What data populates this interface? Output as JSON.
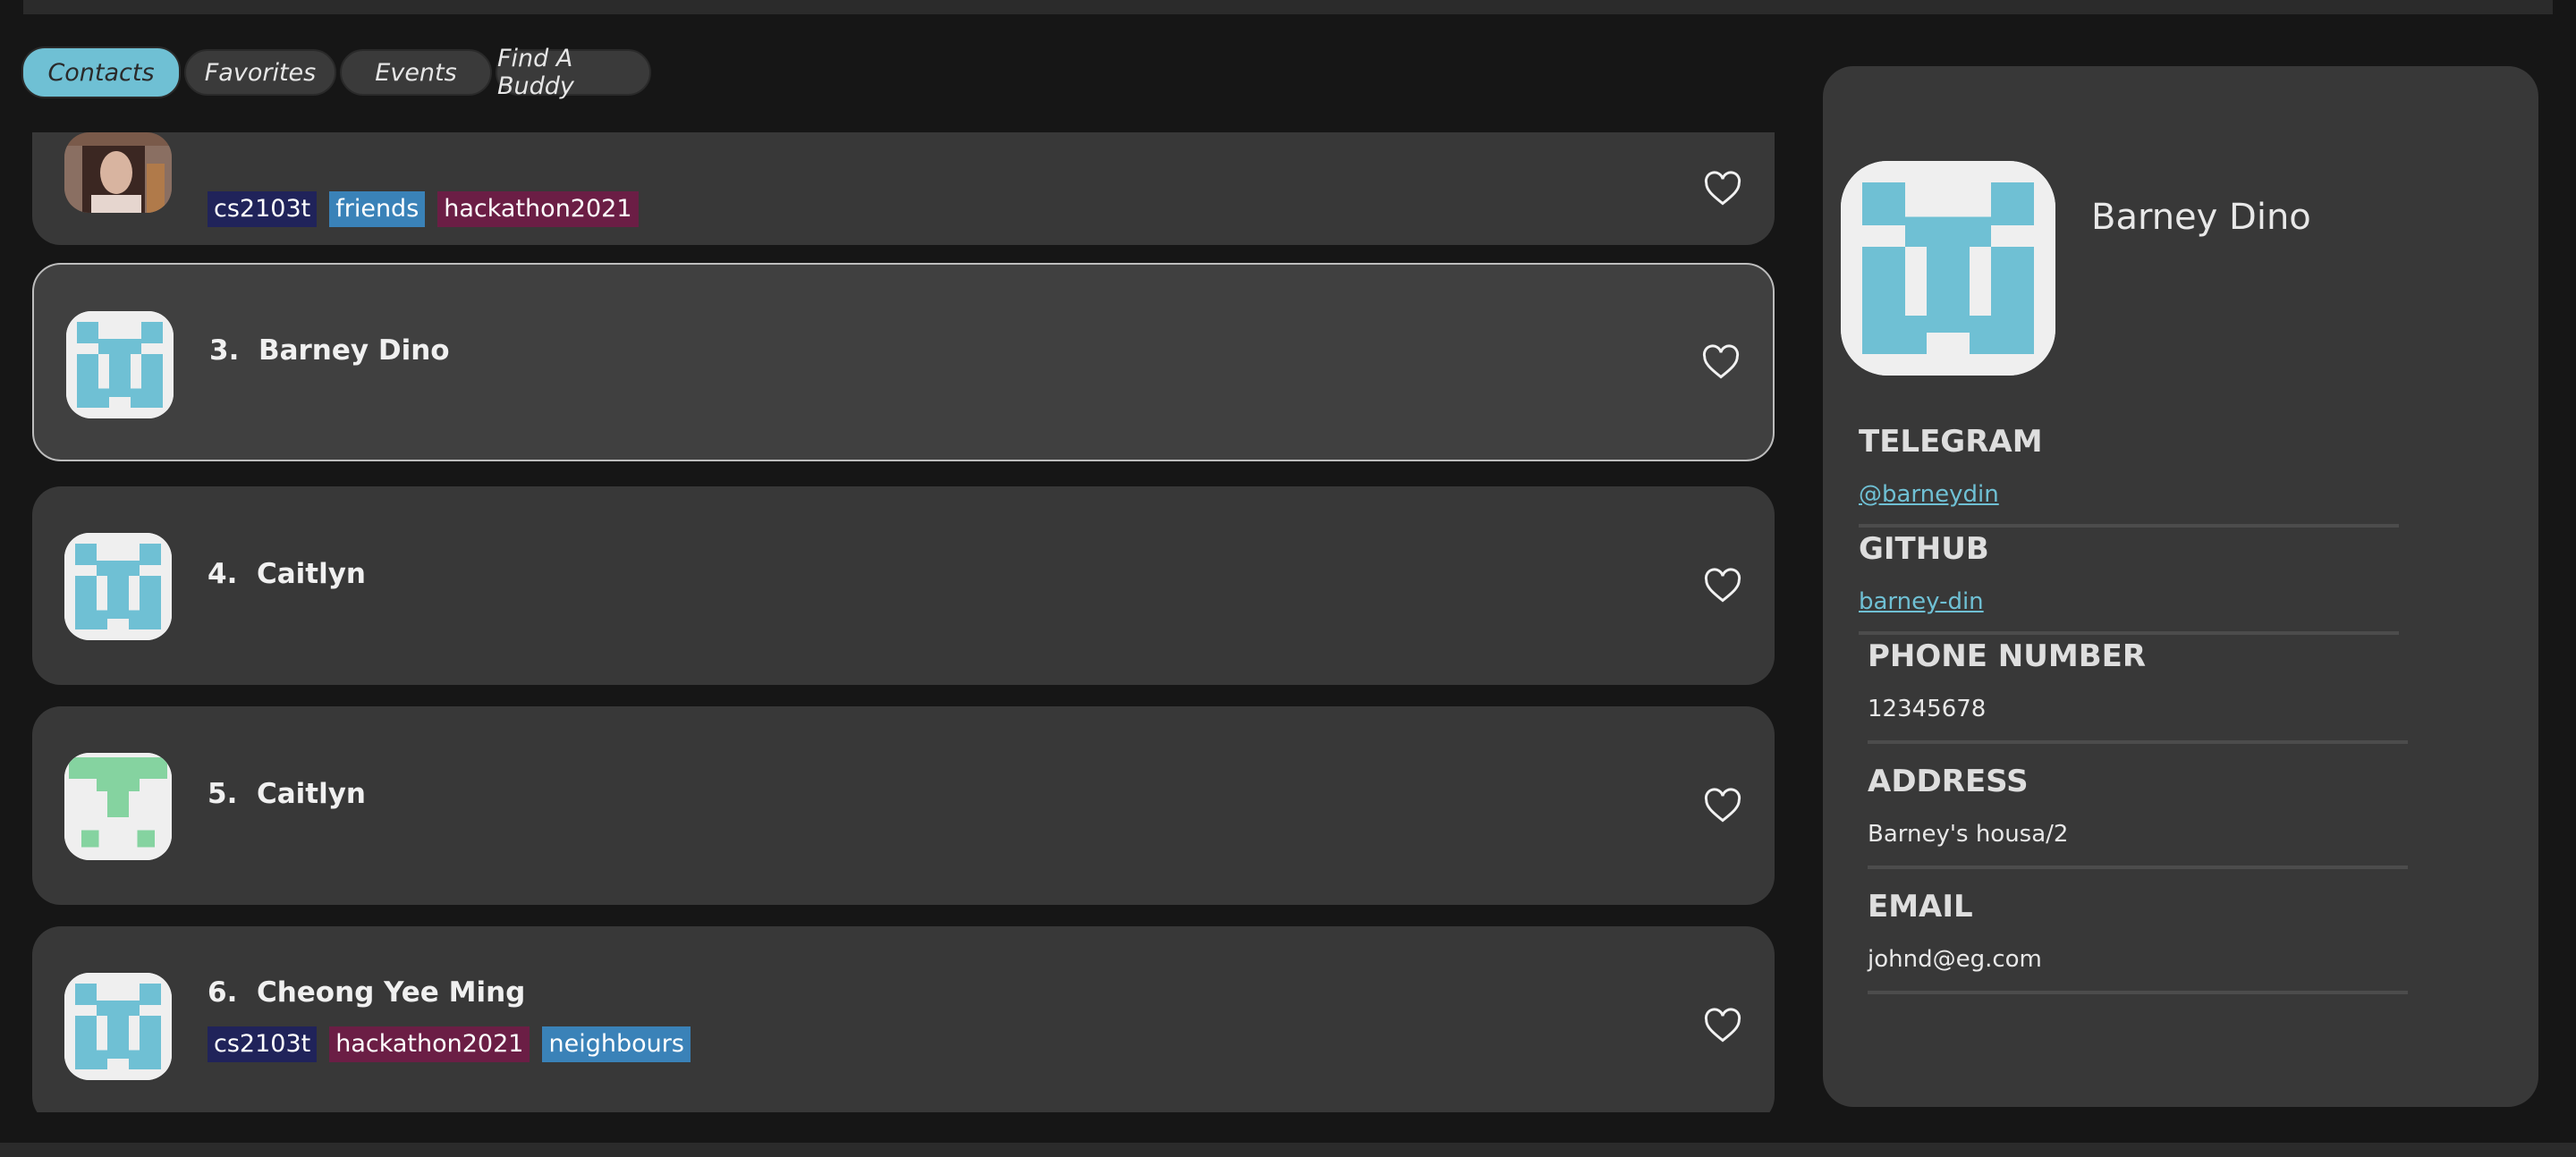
{
  "tabs": [
    {
      "label": "Contacts",
      "active": true
    },
    {
      "label": "Favorites",
      "active": false
    },
    {
      "label": "Events",
      "active": false
    },
    {
      "label": "Find A Buddy",
      "active": false
    }
  ],
  "colors": {
    "accent": "#6fc0d4",
    "tag_cs2103t": "#20235a",
    "tag_friends": "#3a82b8",
    "tag_hackathon2021": "#6b1e45",
    "tag_neighbours": "#3a82b8",
    "avatar_blue": "#6fc0d4",
    "avatar_green": "#85d3a0"
  },
  "contacts": [
    {
      "index": "",
      "name": "",
      "avatar": "photo",
      "tags": [
        "cs2103t",
        "friends",
        "hackathon2021"
      ],
      "favorite": false
    },
    {
      "index": "3.",
      "name": "Barney Dino",
      "avatar": "identicon-blue",
      "tags": [],
      "favorite": false,
      "selected": true
    },
    {
      "index": "4.",
      "name": "Caitlyn",
      "avatar": "identicon-blue",
      "tags": [],
      "favorite": false
    },
    {
      "index": "5.",
      "name": "Caitlyn",
      "avatar": "identicon-green",
      "tags": [],
      "favorite": false
    },
    {
      "index": "6.",
      "name": "Cheong Yee Ming",
      "avatar": "identicon-blue",
      "tags": [
        "cs2103t",
        "hackathon2021",
        "neighbours"
      ],
      "favorite": false
    }
  ],
  "details": {
    "name": "Barney Dino",
    "telegram_label": "TELEGRAM",
    "telegram": "@barneydin",
    "github_label": "GITHUB",
    "github": "barney-din",
    "phone_label": "PHONE NUMBER",
    "phone": "12345678",
    "address_label": "ADDRESS",
    "address": "Barney's housa/2",
    "email_label": "EMAIL",
    "email": "johnd@eg.com"
  }
}
